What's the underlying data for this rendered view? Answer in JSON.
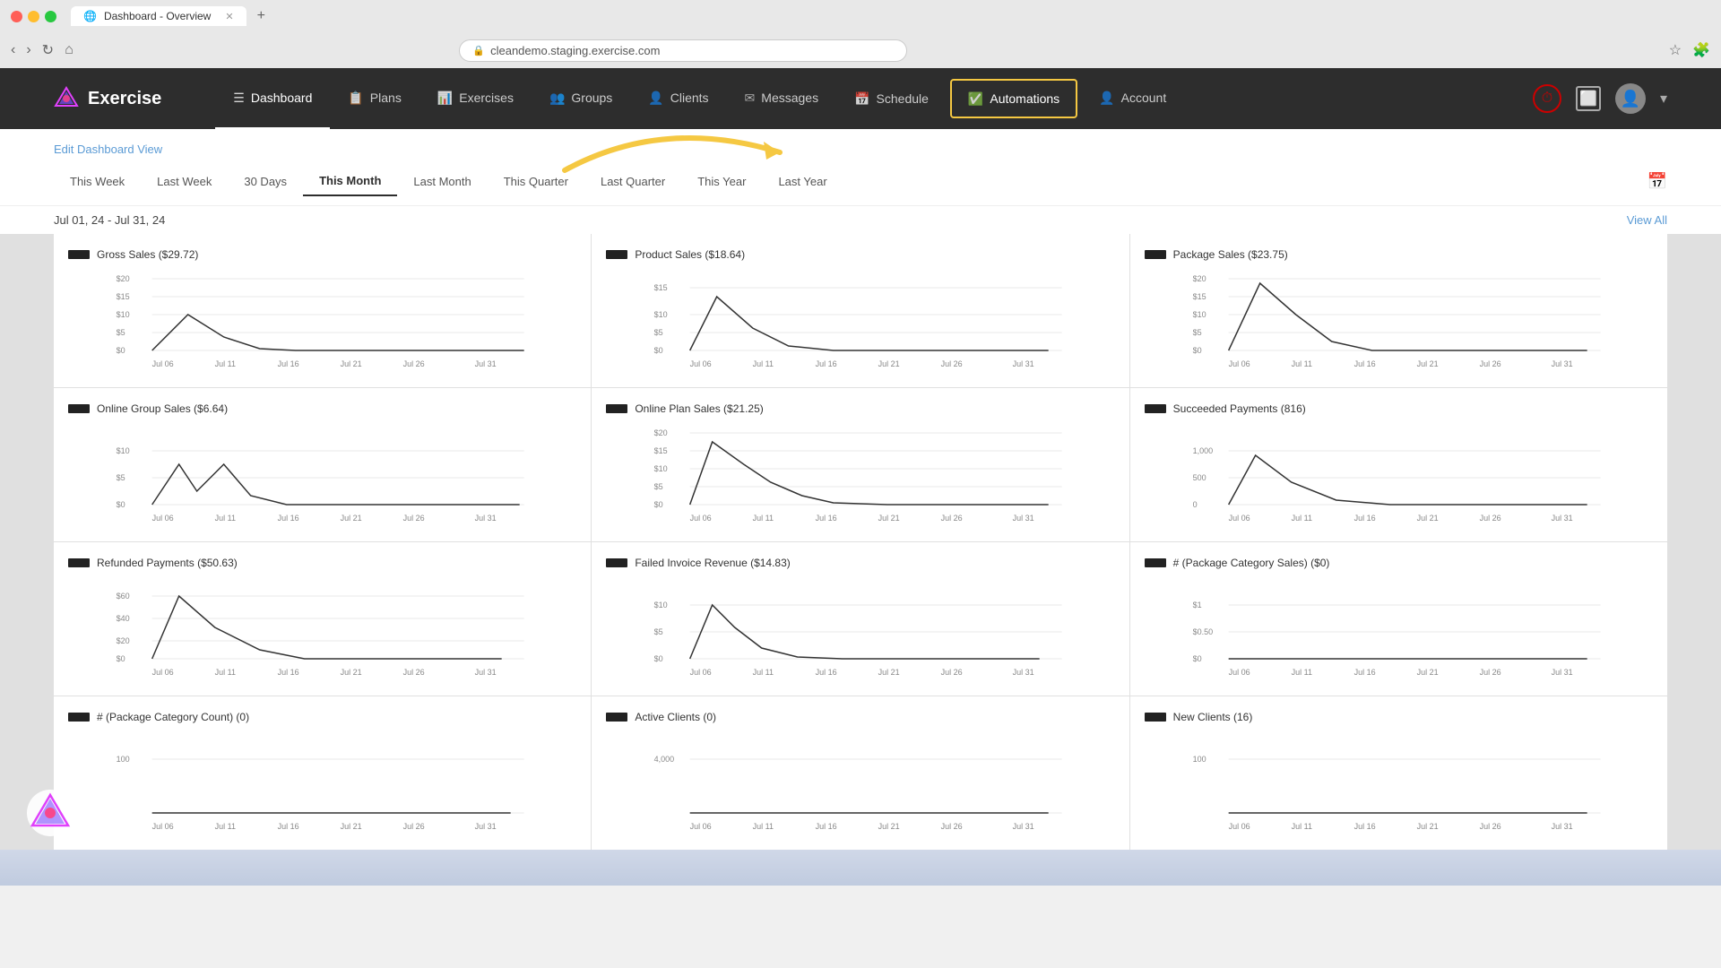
{
  "browser": {
    "tab_title": "Dashboard - Overview",
    "url": "cleandemo.staging.exercise.com"
  },
  "app": {
    "logo_text": "Exercise",
    "nav": {
      "items": [
        {
          "label": "Dashboard",
          "icon": "☰",
          "active": true,
          "id": "dashboard"
        },
        {
          "label": "Plans",
          "icon": "📋",
          "active": false,
          "id": "plans"
        },
        {
          "label": "Exercises",
          "icon": "📊",
          "active": false,
          "id": "exercises"
        },
        {
          "label": "Groups",
          "icon": "👥",
          "active": false,
          "id": "groups"
        },
        {
          "label": "Clients",
          "icon": "👤",
          "active": false,
          "id": "clients"
        },
        {
          "label": "Messages",
          "icon": "✉",
          "active": false,
          "id": "messages"
        },
        {
          "label": "Schedule",
          "icon": "📅",
          "active": false,
          "id": "schedule"
        },
        {
          "label": "Automations",
          "icon": "✅",
          "active": false,
          "id": "automations",
          "highlighted": true
        },
        {
          "label": "Account",
          "icon": "👤",
          "active": false,
          "id": "account"
        }
      ]
    },
    "edit_link": "Edit Dashboard View",
    "date_filters": [
      {
        "label": "This Week",
        "active": false
      },
      {
        "label": "Last Week",
        "active": false
      },
      {
        "label": "30 Days",
        "active": false
      },
      {
        "label": "This Month",
        "active": true
      },
      {
        "label": "Last Month",
        "active": false
      },
      {
        "label": "This Quarter",
        "active": false
      },
      {
        "label": "Last Quarter",
        "active": false
      },
      {
        "label": "This Year",
        "active": false
      },
      {
        "label": "Last Year",
        "active": false
      }
    ],
    "date_range": "Jul 01, 24 - Jul 31, 24",
    "view_all": "View All",
    "charts": [
      {
        "title": "Gross Sales ($29.72)",
        "y_labels": [
          "$20",
          "$15",
          "$10",
          "$5",
          "$0"
        ],
        "x_labels": [
          "Jul 06",
          "Jul 11",
          "Jul 16",
          "Jul 21",
          "Jul 26",
          "Jul 31"
        ]
      },
      {
        "title": "Product Sales ($18.64)",
        "y_labels": [
          "$15",
          "$10",
          "$5",
          "$0"
        ],
        "x_labels": [
          "Jul 06",
          "Jul 11",
          "Jul 16",
          "Jul 21",
          "Jul 26",
          "Jul 31"
        ]
      },
      {
        "title": "Package Sales ($23.75)",
        "y_labels": [
          "$20",
          "$15",
          "$10",
          "$5",
          "$0"
        ],
        "x_labels": [
          "Jul 06",
          "Jul 11",
          "Jul 16",
          "Jul 21",
          "Jul 26",
          "Jul 31"
        ]
      },
      {
        "title": "Online Group Sales ($6.64)",
        "y_labels": [
          "$10",
          "$5",
          "$0"
        ],
        "x_labels": [
          "Jul 06",
          "Jul 11",
          "Jul 16",
          "Jul 21",
          "Jul 26",
          "Jul 31"
        ]
      },
      {
        "title": "Online Plan Sales ($21.25)",
        "y_labels": [
          "$20",
          "$15",
          "$10",
          "$5",
          "$0"
        ],
        "x_labels": [
          "Jul 06",
          "Jul 11",
          "Jul 16",
          "Jul 21",
          "Jul 26",
          "Jul 31"
        ]
      },
      {
        "title": "Succeeded Payments (816)",
        "y_labels": [
          "1,000",
          "500",
          "0"
        ],
        "x_labels": [
          "Jul 06",
          "Jul 11",
          "Jul 16",
          "Jul 21",
          "Jul 26",
          "Jul 31"
        ]
      },
      {
        "title": "Refunded Payments ($50.63)",
        "y_labels": [
          "$60",
          "$40",
          "$20",
          "$0"
        ],
        "x_labels": [
          "Jul 06",
          "Jul 11",
          "Jul 16",
          "Jul 21",
          "Jul 26",
          "Jul 31"
        ]
      },
      {
        "title": "Failed Invoice Revenue ($14.83)",
        "y_labels": [
          "$10",
          "$5",
          "$0"
        ],
        "x_labels": [
          "Jul 06",
          "Jul 11",
          "Jul 16",
          "Jul 21",
          "Jul 26",
          "Jul 31"
        ]
      },
      {
        "title": "# (Package Category Sales) ($0)",
        "y_labels": [
          "$1",
          "$0.50",
          "$0"
        ],
        "x_labels": [
          "Jul 06",
          "Jul 11",
          "Jul 16",
          "Jul 21",
          "Jul 26",
          "Jul 31"
        ]
      },
      {
        "title": "# (Package Category Count) (0)",
        "y_labels": [
          "100"
        ],
        "x_labels": [
          "Jul 06",
          "Jul 11",
          "Jul 16",
          "Jul 21",
          "Jul 26",
          "Jul 31"
        ]
      },
      {
        "title": "Active Clients (0)",
        "y_labels": [
          "4,000"
        ],
        "x_labels": [
          "Jul 06",
          "Jul 11",
          "Jul 16",
          "Jul 21",
          "Jul 26",
          "Jul 31"
        ]
      },
      {
        "title": "New Clients (16)",
        "y_labels": [
          "100"
        ],
        "x_labels": [
          "Jul 06",
          "Jul 11",
          "Jul 16",
          "Jul 21",
          "Jul 26",
          "Jul 31"
        ]
      }
    ]
  }
}
